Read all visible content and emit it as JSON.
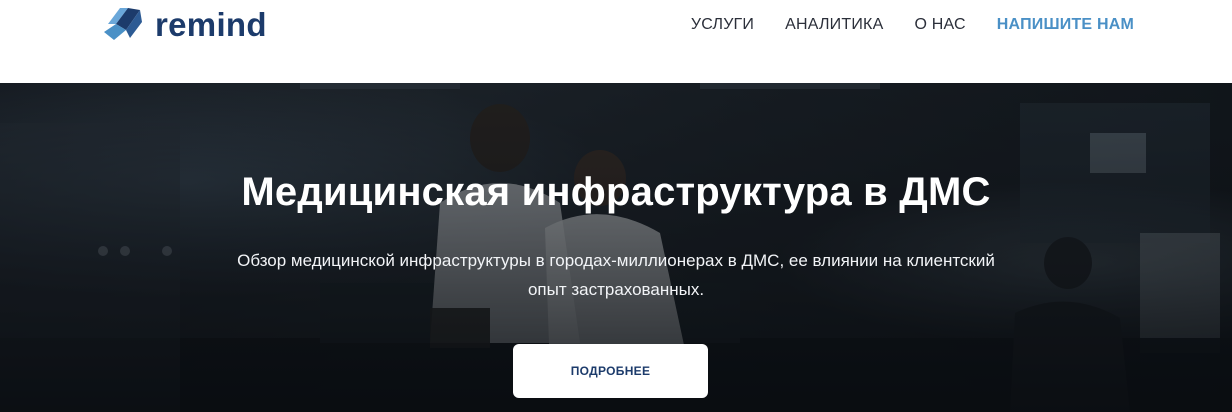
{
  "header": {
    "logo_text": "remind",
    "logo_icon": "remind-logo-icon",
    "nav": [
      {
        "label": "УСЛУГИ"
      },
      {
        "label": "АНАЛИТИКА"
      },
      {
        "label": "О НАС"
      },
      {
        "label": "НАПИШИТЕ НАМ"
      }
    ]
  },
  "hero": {
    "title": "Медицинская инфраструктура в ДМС",
    "subtitle": "Обзор медицинской инфраструктуры в городах-миллионерах в ДМС, ее влиянии на клиентский опыт застрахованных.",
    "button_label": "ПОДРОБНЕЕ",
    "background_image": "laboratory-scientists-photo"
  },
  "colors": {
    "brand_dark": "#1c3b6b",
    "brand_light": "#4a90c6",
    "nav_text": "#2b2f3a",
    "hero_overlay": "#10161c"
  }
}
